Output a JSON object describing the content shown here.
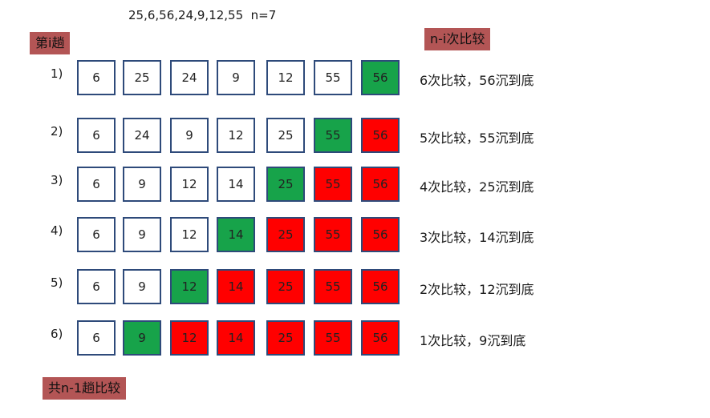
{
  "header": "25,6,56,24,9,12,55  n=7",
  "tags": {
    "pass": "第i趟",
    "compare": "n-i次比较",
    "total": "共n-1趟比较"
  },
  "colors": {
    "sunk": "#ff0000",
    "current": "#17a34a",
    "default": "#ffffff",
    "border": "#2e4a7a",
    "tag": "#b35555"
  },
  "rows": [
    {
      "label": "1)",
      "cells": [
        "6",
        "25",
        "24",
        "9",
        "12",
        "55",
        "56"
      ],
      "states": [
        "n",
        "n",
        "n",
        "n",
        "n",
        "n",
        "g"
      ],
      "desc": "6次比较，56沉到底"
    },
    {
      "label": "2)",
      "cells": [
        "6",
        "24",
        "9",
        "12",
        "25",
        "55",
        "56"
      ],
      "states": [
        "n",
        "n",
        "n",
        "n",
        "n",
        "g",
        "r"
      ],
      "desc": "5次比较，55沉到底"
    },
    {
      "label": "3)",
      "cells": [
        "6",
        "9",
        "12",
        "14",
        "25",
        "55",
        "56"
      ],
      "states": [
        "n",
        "n",
        "n",
        "n",
        "g",
        "r",
        "r"
      ],
      "desc": "4次比较，25沉到底"
    },
    {
      "label": "4)",
      "cells": [
        "6",
        "9",
        "12",
        "14",
        "25",
        "55",
        "56"
      ],
      "states": [
        "n",
        "n",
        "n",
        "g",
        "r",
        "r",
        "r"
      ],
      "desc": "3次比较，14沉到底"
    },
    {
      "label": "5)",
      "cells": [
        "6",
        "9",
        "12",
        "14",
        "25",
        "55",
        "56"
      ],
      "states": [
        "n",
        "n",
        "g",
        "r",
        "r",
        "r",
        "r"
      ],
      "desc": "2次比较，12沉到底"
    },
    {
      "label": "6)",
      "cells": [
        "6",
        "9",
        "12",
        "14",
        "25",
        "55",
        "56"
      ],
      "states": [
        "n",
        "g",
        "r",
        "r",
        "r",
        "r",
        "r"
      ],
      "desc": "1次比较，9沉到底"
    }
  ]
}
